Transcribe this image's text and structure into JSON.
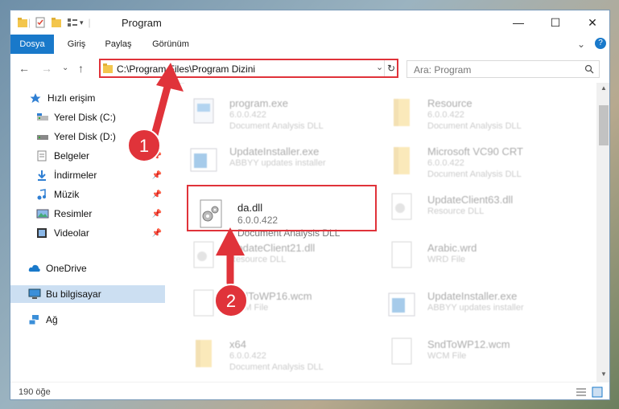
{
  "window": {
    "title": "Program",
    "controls": {
      "minimize": "—",
      "maximize": "☐",
      "close": "✕"
    }
  },
  "ribbon": {
    "tabs": [
      "Dosya",
      "Giriş",
      "Paylaş",
      "Görünüm"
    ]
  },
  "address": {
    "path": "C:\\Program Files\\Program Dizini",
    "search_placeholder": "Ara: Program"
  },
  "nav": {
    "items": [
      {
        "label": "Hızlı erişim",
        "icon": "star-icon"
      },
      {
        "label": "Yerel Disk (C:)",
        "icon": "drive-icon"
      },
      {
        "label": "Yerel Disk (D:)",
        "icon": "drive-icon"
      },
      {
        "label": "Belgeler",
        "icon": "documents-icon"
      },
      {
        "label": "İndirmeler",
        "icon": "download-icon"
      },
      {
        "label": "Müzik",
        "icon": "music-icon"
      },
      {
        "label": "Resimler",
        "icon": "pictures-icon"
      },
      {
        "label": "Videolar",
        "icon": "video-icon"
      },
      {
        "label": "OneDrive",
        "icon": "cloud-icon"
      },
      {
        "label": "Bu bilgisayar",
        "icon": "computer-icon"
      },
      {
        "label": "Ağ",
        "icon": "network-icon"
      }
    ]
  },
  "files": [
    {
      "name": "program.exe",
      "version": "6.0.0.422",
      "type": "Document Analysis DLL"
    },
    {
      "name": "Resource",
      "version": "6.0.0.422",
      "type": "Document Analysis DLL"
    },
    {
      "name": "UpdateInstaller.exe",
      "version": "ABBYY updates installer",
      "type": ""
    },
    {
      "name": "Microsoft VC90 CRT",
      "version": "6.0.0.422",
      "type": "Document Analysis DLL"
    },
    {
      "name": "da.dll",
      "version": "6.0.0.422",
      "type": "Document Analysis DLL"
    },
    {
      "name": "UpdateClient63.dll",
      "version": "Resource DLL",
      "type": ""
    },
    {
      "name": "UpdateClient21.dll",
      "version": "Resource DLL",
      "type": ""
    },
    {
      "name": "Arabic.wrd",
      "version": "WRD File",
      "type": ""
    },
    {
      "name": "SndToWP16.wcm",
      "version": "WCM File",
      "type": ""
    },
    {
      "name": "UpdateInstaller.exe",
      "version": "ABBYY updates installer",
      "type": ""
    },
    {
      "name": "x64",
      "version": "6.0.0.422",
      "type": "Document Analysis DLL"
    },
    {
      "name": "SndToWP12.wcm",
      "version": "WCM File",
      "type": ""
    }
  ],
  "status": {
    "count": "190 öğe"
  },
  "annotations": {
    "step1": "1",
    "step2": "2"
  },
  "colors": {
    "accent": "#1979ca",
    "highlight": "#e0333a",
    "arrow": "#e0333a"
  }
}
